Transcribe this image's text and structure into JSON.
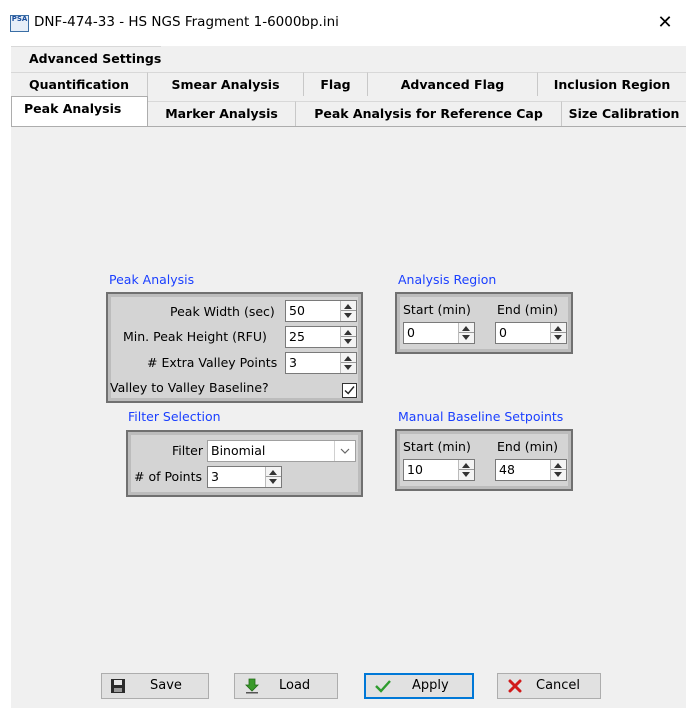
{
  "window": {
    "title": "DNF-474-33 - HS NGS Fragment 1-6000bp.ini",
    "icon_label": "PSA",
    "close_label": "✕"
  },
  "tabs": {
    "row1": [
      "Advanced Settings"
    ],
    "row2": [
      "Quantification",
      "Smear Analysis",
      "Flag",
      "Advanced Flag",
      "Inclusion Region"
    ],
    "row3": [
      "Peak Analysis",
      "Marker Analysis",
      "Peak Analysis for Reference Cap",
      "Size Calibration"
    ],
    "active": "Peak Analysis"
  },
  "peak_analysis": {
    "title": "Peak Analysis",
    "peak_width_label": "Peak Width (sec)",
    "peak_width_value": "50",
    "min_peak_height_label": "Min. Peak Height (RFU)",
    "min_peak_height_value": "25",
    "extra_valley_label": "# Extra Valley Points",
    "extra_valley_value": "3",
    "valley_baseline_label": "Valley to Valley Baseline?",
    "valley_baseline_checked": true
  },
  "analysis_region": {
    "title": "Analysis Region",
    "start_label": "Start (min)",
    "end_label": "End (min)",
    "start_value": "0",
    "end_value": "0"
  },
  "filter_selection": {
    "title": "Filter Selection",
    "filter_label": "Filter",
    "filter_value": "Binomial",
    "points_label": "# of Points",
    "points_value": "3"
  },
  "manual_baseline": {
    "title": "Manual Baseline Setpoints",
    "start_label": "Start (min)",
    "end_label": "End (min)",
    "start_value": "10",
    "end_value": "48"
  },
  "buttons": {
    "save": "Save",
    "load": "Load",
    "apply": "Apply",
    "cancel": "Cancel"
  },
  "colors": {
    "group_title": "#1a3fff",
    "apply_border": "#0078d7",
    "cancel_icon": "#d11a1a",
    "apply_icon": "#2e9c2e",
    "load_icon": "#3a9a2a"
  }
}
